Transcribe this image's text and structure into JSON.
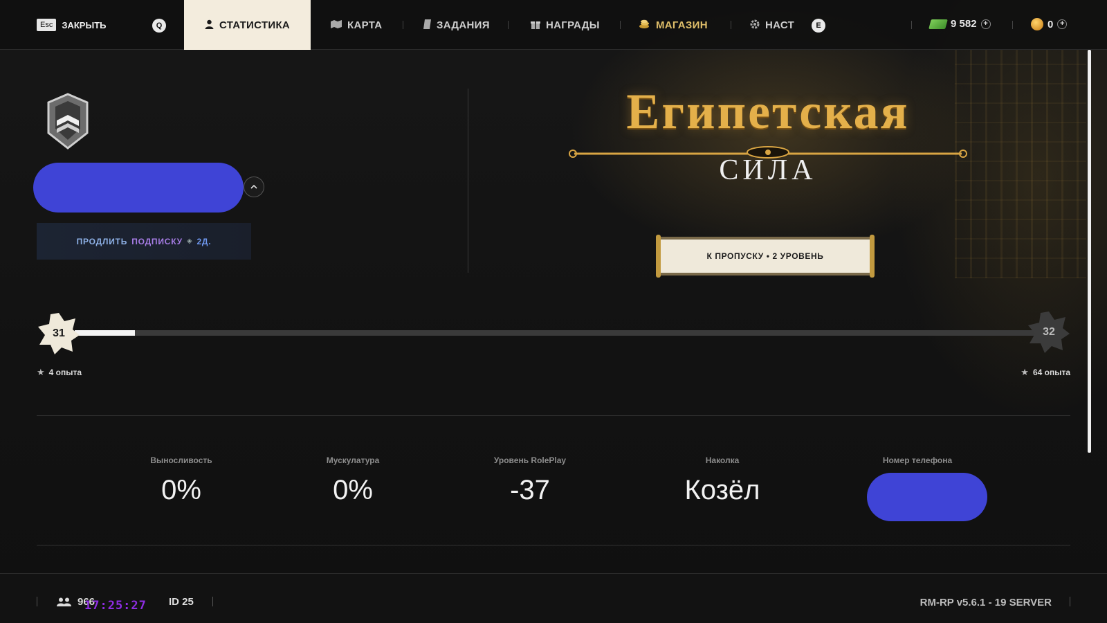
{
  "nav": {
    "close_key": "Esc",
    "close_label": "ЗАКРЫТЬ",
    "left_key": "Q",
    "right_key": "E",
    "tabs": [
      {
        "label": "СТАТИСТИКА",
        "icon": "person-icon",
        "active": true
      },
      {
        "label": "КАРТА",
        "icon": "map-icon"
      },
      {
        "label": "ЗАДАНИЯ",
        "icon": "scroll-icon"
      },
      {
        "label": "НАГРАДЫ",
        "icon": "gift-icon"
      },
      {
        "label": "МАГАЗИН",
        "icon": "coins-icon",
        "color": "#e0bf6a"
      },
      {
        "label": "НАСТ",
        "icon": "gear-icon"
      }
    ]
  },
  "currency": {
    "cash": "9 582",
    "coins": "0"
  },
  "profile": {
    "subscription": {
      "part1": "ПРОДЛИТЬ",
      "part2": "ПОДПИСКУ",
      "days": "2Д."
    }
  },
  "event": {
    "title_line1": "Египетская",
    "title_line2": "СИЛА",
    "pass_button": "К ПРОПУСКУ • 2 УРОВЕНЬ"
  },
  "level": {
    "current": "31",
    "next": "32",
    "current_xp": "4 опыта",
    "required_xp": "64 опыта",
    "progress_fraction": 0.0625
  },
  "stats": [
    {
      "label": "Выносливость",
      "value": "0%"
    },
    {
      "label": "Мускулатура",
      "value": "0%"
    },
    {
      "label": "Уровень RolePlay",
      "value": "-37"
    },
    {
      "label": "Наколка",
      "value": "Козёл"
    },
    {
      "label": "Номер телефона",
      "value": ""
    }
  ],
  "footer": {
    "online": "966",
    "clock": "17:25:27",
    "player_id": "ID 25",
    "version": "RM-RP v5.6.1 - 19 SERVER"
  },
  "colors": {
    "accent_gold": "#e4b04a",
    "active_tab_bg": "#f3ecdd",
    "redaction_blue": "#3f44d6",
    "clock_purple": "#8e2de2"
  }
}
